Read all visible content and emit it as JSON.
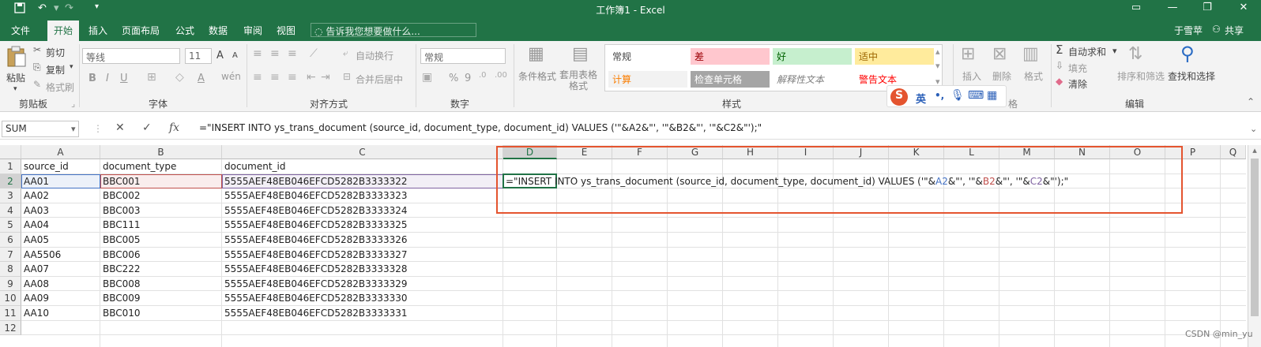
{
  "window": {
    "title": "工作簿1 - Excel",
    "icons": [
      "save-icon",
      "undo-icon",
      "redo-icon",
      "customize-icon",
      "ribbon-display-icon",
      "minimize-icon",
      "restore-icon",
      "close-icon"
    ]
  },
  "tabs": [
    "文件",
    "开始",
    "插入",
    "页面布局",
    "公式",
    "数据",
    "审阅",
    "视图"
  ],
  "active_tab": "开始",
  "tell_me": "告诉我您想要做什么...",
  "user": {
    "name": "于雪苹",
    "share": "共享"
  },
  "ribbon": {
    "clipboard": {
      "paste": "粘贴",
      "cut": "剪切",
      "copy": "复制",
      "format_painter": "格式刷",
      "group": "剪贴板"
    },
    "font": {
      "name": "等线",
      "size": "11",
      "bold": "B",
      "italic": "I",
      "underline": "U",
      "group": "字体",
      "grow": "A",
      "shrink": "A",
      "wen": "wén",
      "fill": "A"
    },
    "alignment": {
      "wrap": "自动换行",
      "merge": "合并后居中",
      "group": "对齐方式"
    },
    "number": {
      "format": "常规",
      "percent": "%",
      "comma": "9",
      "group": "数字"
    },
    "styles": {
      "conditional": "条件格式",
      "table": "套用表格格式",
      "cells": [
        {
          "label": "常规",
          "bg": "#ffffff",
          "fg": "#444444"
        },
        {
          "label": "差",
          "bg": "#ffc7ce",
          "fg": "#9c0006"
        },
        {
          "label": "好",
          "bg": "#c6efce",
          "fg": "#006100"
        },
        {
          "label": "适中",
          "bg": "#ffeb9c",
          "fg": "#9c6500"
        },
        {
          "label": "计算",
          "bg": "#f2f2f2",
          "fg": "#fa7d00"
        },
        {
          "label": "检查单元格",
          "bg": "#a5a5a5",
          "fg": "#ffffff"
        },
        {
          "label": "解释性文本",
          "bg": "#ffffff",
          "fg": "#7f7f7f"
        },
        {
          "label": "警告文本",
          "bg": "#ffffff",
          "fg": "#ff0000"
        }
      ],
      "group": "样式"
    },
    "cells_group": {
      "insert": "插入",
      "delete": "删除",
      "format": "格式",
      "group_suffix": "格"
    },
    "editing": {
      "autosum": "自动求和",
      "fill": "填充",
      "clear": "清除",
      "sort": "排序和筛选",
      "find": "查找和选择",
      "group": "编辑"
    }
  },
  "ime": {
    "lang": "英",
    "punct": "•,",
    "icons": [
      "sogou-icon",
      "mic-icon",
      "keyboard-icon",
      "grid-icon"
    ]
  },
  "formula_bar": {
    "name_box": "SUM",
    "cancel": "✕",
    "enter": "✓",
    "fx": "fx",
    "formula": "=\"INSERT INTO ys_trans_document (source_id, document_type, document_id) VALUES ('\"&A2&\"', '\"&B2&\"', '\"&C2&\"');\""
  },
  "columns": [
    "A",
    "B",
    "C",
    "D",
    "E",
    "F",
    "G",
    "H",
    "I",
    "J",
    "K",
    "L",
    "M",
    "N",
    "O",
    "P",
    "Q"
  ],
  "row_numbers": [
    "1",
    "2",
    "3",
    "4",
    "5",
    "6",
    "7",
    "8",
    "9",
    "10",
    "11",
    "12"
  ],
  "rows": [
    [
      "source_id",
      "document_type",
      "document_id"
    ],
    [
      "AA01",
      "BBC001",
      "5555AEF48EB046EFCD5282B3333322"
    ],
    [
      "AA02",
      "BBC002",
      "5555AEF48EB046EFCD5282B3333323"
    ],
    [
      "AA03",
      "BBC003",
      "5555AEF48EB046EFCD5282B3333324"
    ],
    [
      "AA04",
      "BBC111",
      "5555AEF48EB046EFCD5282B3333325"
    ],
    [
      "AA05",
      "BBC005",
      "5555AEF48EB046EFCD5282B3333326"
    ],
    [
      "AA5506",
      "BBC006",
      "5555AEF48EB046EFCD5282B3333327"
    ],
    [
      "AA07",
      "BBC222",
      "5555AEF48EB046EFCD5282B3333328"
    ],
    [
      "AA08",
      "BBC008",
      "5555AEF48EB046EFCD5282B3333329"
    ],
    [
      "AA09",
      "BBC009",
      "5555AEF48EB046EFCD5282B3333330"
    ],
    [
      "AA10",
      "BBC010",
      "5555AEF48EB046EFCD5282B3333331"
    ]
  ],
  "edit_cell": {
    "address": "D2",
    "parts": [
      {
        "t": "=\"INSERT INTO ys_trans_document (source_id, document_type, document_id) VALUES ('\"&",
        "c": "#222222"
      },
      {
        "t": "A2",
        "c": "#4472c4"
      },
      {
        "t": "&\"', '\"&",
        "c": "#222222"
      },
      {
        "t": "B2",
        "c": "#c0504d"
      },
      {
        "t": "&\"', '\"&",
        "c": "#222222"
      },
      {
        "t": "C2",
        "c": "#8064a2"
      },
      {
        "t": "&\"');\"",
        "c": "#222222"
      }
    ]
  },
  "colors": {
    "excel_green": "#217346",
    "highlight_red": "#e4542f",
    "ref_blue": "#4472c4",
    "ref_red": "#c0504d",
    "ref_purple": "#8064a2"
  },
  "watermark": "CSDN @min_yu"
}
